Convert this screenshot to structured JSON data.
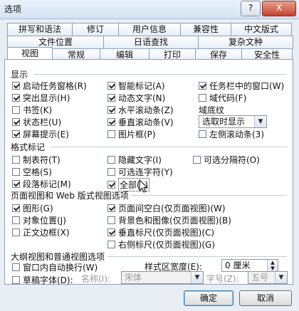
{
  "window": {
    "title": "选项",
    "help_label": "?",
    "close_label": "X"
  },
  "tabs": {
    "row1": [
      "拼写和语法",
      "修订",
      "用户信息",
      "兼容性",
      "中文版式"
    ],
    "row2": [
      "文件位置",
      "日语查找",
      "复杂文种"
    ],
    "row3": [
      "视图",
      "常规",
      "编辑",
      "打印",
      "保存",
      "安全性"
    ],
    "active": "视图"
  },
  "display": {
    "heading": "显示",
    "items": [
      {
        "label": "启动任务窗格(R)",
        "checked": true
      },
      {
        "label": "智能标记(A)",
        "checked": true
      },
      {
        "label": "任务栏中的窗口(W)",
        "checked": true
      },
      {
        "label": "突出显示(H)",
        "checked": true
      },
      {
        "label": "动态文字(N)",
        "checked": true
      },
      {
        "label": "域代码(F)",
        "checked": false
      },
      {
        "label": "书签(K)",
        "checked": false
      },
      {
        "label": "水平滚动条(Z)",
        "checked": true
      },
      {
        "label": "状态栏(U)",
        "checked": true
      },
      {
        "label": "垂直滚动条(V)",
        "checked": true
      },
      {
        "label": "屏幕提示(E)",
        "checked": true
      },
      {
        "label": "图片框(P)",
        "checked": false
      },
      {
        "label": "左侧滚动条(3)",
        "checked": false
      }
    ],
    "field_shading_label": "域底纹",
    "field_shading_value": "选取时显示"
  },
  "format_marks": {
    "heading": "格式标记",
    "items": [
      {
        "label": "制表符(T)",
        "checked": false
      },
      {
        "label": "隐藏文字(I)",
        "checked": false
      },
      {
        "label": "可选分隔符(O)",
        "checked": false
      },
      {
        "label": "空格(S)",
        "checked": false
      },
      {
        "label": "可选连字符(Y)",
        "checked": false
      },
      {
        "label": "段落标记(M)",
        "checked": true
      },
      {
        "label": "全部(L)",
        "checked": true
      }
    ]
  },
  "print_view": {
    "heading": "页面视图和 Web 版式视图选项",
    "items": [
      {
        "label": "图形(G)",
        "checked": true
      },
      {
        "label": "页面间空白(仅页面视图)(W)",
        "checked": true
      },
      {
        "label": "对象位置(J)",
        "checked": false
      },
      {
        "label": "背景色和图像(仅页面视图)(B)",
        "checked": false
      },
      {
        "label": "正文边框(X)",
        "checked": false
      },
      {
        "label": "垂直标尺(仅页面视图)(C)",
        "checked": true
      },
      {
        "label": "右侧标尺(仅页面视图)(G)",
        "checked": false
      }
    ]
  },
  "outline_view": {
    "heading": "大纲视图和普通视图选项",
    "wrap_label": "窗口内自动换行(W)",
    "wrap_checked": false,
    "draft_label": "草稿字体(D):",
    "draft_checked": false,
    "style_width_label": "样式区宽度(E):",
    "style_width_value": "0 厘米",
    "name_label": "名称(I):",
    "name_value": "宋体",
    "size_label": "字号(Z):",
    "size_value": "五号"
  },
  "buttons": {
    "ok": "确定",
    "cancel": "取消"
  }
}
